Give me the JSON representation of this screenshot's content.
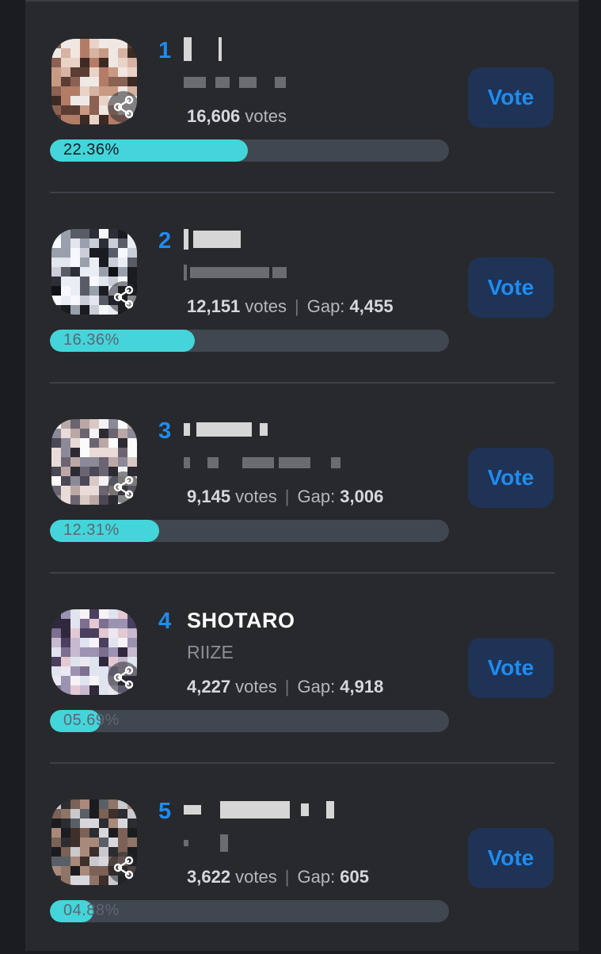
{
  "button_label": "Vote",
  "votes_suffix": "votes",
  "gap_label": "Gap:",
  "entries": [
    {
      "rank": "1",
      "name": "",
      "group": "",
      "votes": "16,606",
      "gap": "",
      "percent": "22.36%",
      "fraction": 0.2236
    },
    {
      "rank": "2",
      "name": "",
      "group": "",
      "votes": "12,151",
      "gap": "4,455",
      "percent": "16.36%",
      "fraction": 0.1636
    },
    {
      "rank": "3",
      "name": "",
      "group": "",
      "votes": "9,145",
      "gap": "3,006",
      "percent": "12.31%",
      "fraction": 0.1231
    },
    {
      "rank": "4",
      "name": "SHOTARO",
      "group": "RIIZE",
      "votes": "4,227",
      "gap": "4,918",
      "percent": "05.69%",
      "fraction": 0.0569
    },
    {
      "rank": "5",
      "name": "",
      "group": "",
      "votes": "3,622",
      "gap": "605",
      "percent": "04.88%",
      "fraction": 0.0488
    }
  ],
  "colors": {
    "accent": "#1e8cf0",
    "progress": "#43d5da",
    "background": "#28292d",
    "button": "#1f3356"
  },
  "icons": {
    "share": "share-icon"
  }
}
